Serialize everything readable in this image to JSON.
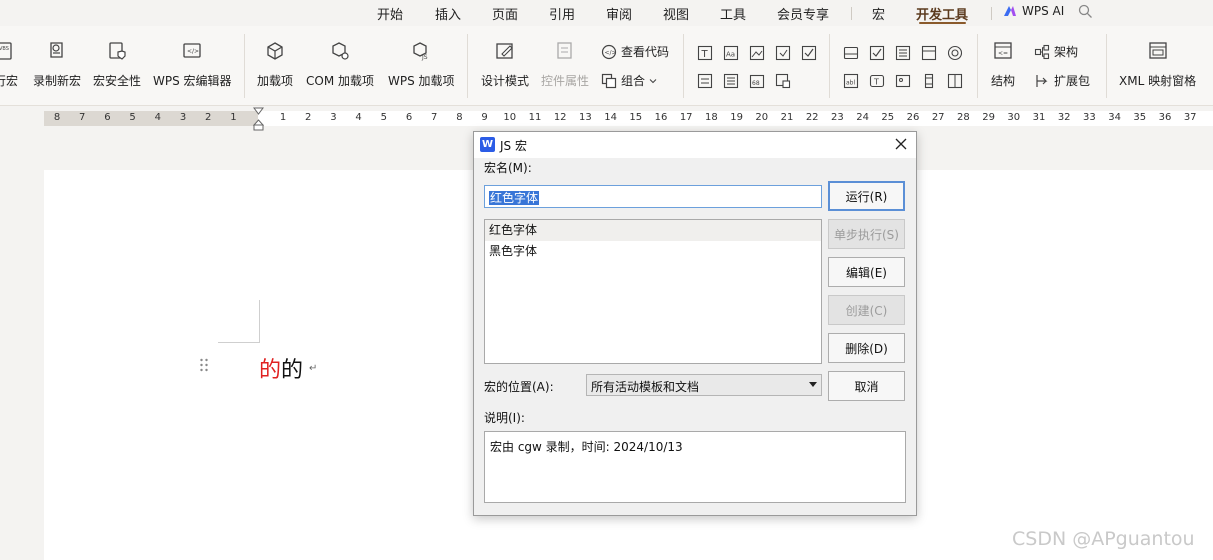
{
  "menu": {
    "tabs": [
      "开始",
      "插入",
      "页面",
      "引用",
      "审阅",
      "视图",
      "工具",
      "会员专享",
      "宏",
      "开发工具"
    ],
    "active_tab": "开发工具",
    "ai_label": "WPS AI"
  },
  "ribbon": {
    "run_macro": "行宏",
    "record_macro": "录制新宏",
    "macro_security": "宏安全性",
    "wps_macro_editor": "WPS 宏编辑器",
    "addins": "加载项",
    "com_addins": "COM 加载项",
    "wps_addins": "WPS 加载项",
    "design_mode": "设计模式",
    "control_props": "控件属性",
    "view_code": "查看代码",
    "group": "组合",
    "structure": "结构",
    "schema": "架构",
    "expansion_pack": "扩展包",
    "xml_mapping": "XML 映射窗格"
  },
  "ruler": {
    "negative": [
      "8",
      "7",
      "6",
      "5",
      "4",
      "3",
      "2",
      "1"
    ],
    "positive": [
      "1",
      "2",
      "3",
      "4",
      "5",
      "6",
      "7",
      "8",
      "9",
      "10",
      "11",
      "12",
      "13",
      "14",
      "15",
      "16",
      "17",
      "18",
      "19",
      "20",
      "21",
      "22",
      "23",
      "24",
      "25",
      "26",
      "27",
      "28",
      "29",
      "30",
      "31",
      "32",
      "33",
      "34",
      "35",
      "36",
      "37"
    ]
  },
  "document": {
    "red_char": "的",
    "black_char": "的",
    "paragraph_mark": "↵"
  },
  "dialog": {
    "logo": "W",
    "title": "JS 宏",
    "macro_name_label": "宏名(M):",
    "macro_name_value": "红色字体",
    "macros": [
      "红色字体",
      "黑色字体"
    ],
    "selected_index": 0,
    "buttons": {
      "run": "运行(R)",
      "step": "单步执行(S)",
      "edit": "编辑(E)",
      "create": "创建(C)",
      "delete": "删除(D)",
      "cancel": "取消"
    },
    "location_label": "宏的位置(A):",
    "location_value": "所有活动模板和文档",
    "description_label": "说明(I):",
    "description": "宏由 cgw 录制，时间: 2024/10/13"
  },
  "watermark": "CSDN @APguantou"
}
